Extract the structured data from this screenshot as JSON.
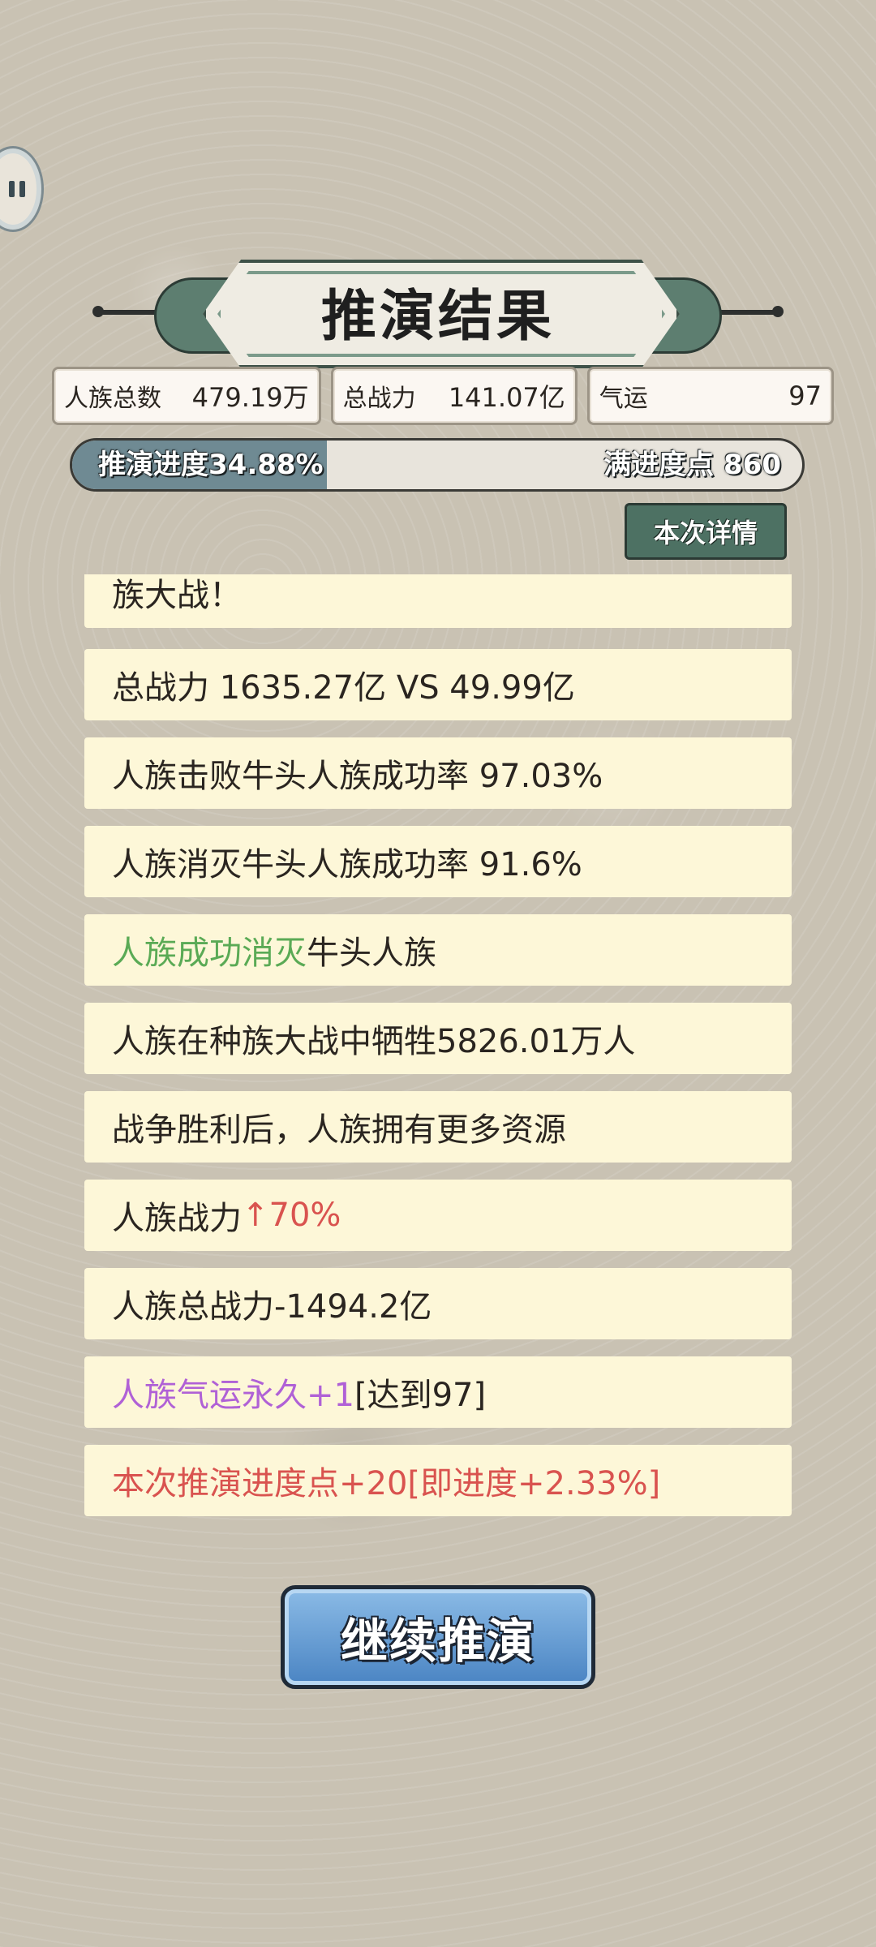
{
  "title": "推演结果",
  "stats": [
    {
      "label": "人族总数",
      "value": "479.19万"
    },
    {
      "label": "总战力",
      "value": "141.07亿"
    },
    {
      "label": "气运",
      "value": "97"
    }
  ],
  "progress": {
    "label": "推演进度34.88%",
    "percent": 34.88,
    "right_label": "满进度点 860"
  },
  "details_button": "本次详情",
  "log": [
    {
      "parts": [
        {
          "text": "族大战！",
          "color": "default"
        }
      ]
    },
    {
      "parts": [
        {
          "text": "总战力 1635.27亿 VS 49.99亿",
          "color": "default"
        }
      ]
    },
    {
      "parts": [
        {
          "text": "人族击败牛头人族成功率 97.03%",
          "color": "default"
        }
      ]
    },
    {
      "parts": [
        {
          "text": "人族消灭牛头人族成功率 91.6%",
          "color": "default"
        }
      ]
    },
    {
      "parts": [
        {
          "text": "人族成功消灭",
          "color": "green"
        },
        {
          "text": "牛头人族",
          "color": "default"
        }
      ]
    },
    {
      "parts": [
        {
          "text": "人族在种族大战中牺牲5826.01万人",
          "color": "default"
        }
      ]
    },
    {
      "parts": [
        {
          "text": "战争胜利后，人族拥有更多资源",
          "color": "default"
        }
      ]
    },
    {
      "parts": [
        {
          "text": "人族战力 ",
          "color": "default"
        },
        {
          "text": "↑70%",
          "color": "red"
        }
      ]
    },
    {
      "parts": [
        {
          "text": "人族总战力-1494.2亿",
          "color": "default"
        }
      ]
    },
    {
      "parts": [
        {
          "text": "人族气运永久+1",
          "color": "purple"
        },
        {
          "text": "[达到97]",
          "color": "default"
        }
      ]
    },
    {
      "parts": [
        {
          "text": "本次推演进度点+20[即进度+2.33%]",
          "color": "red"
        }
      ]
    }
  ],
  "continue_button": "继续推演",
  "colors": {
    "green": "#5aaa55",
    "red": "#d9534f",
    "purple": "#b061d6",
    "card_bg": "#fdf7d8"
  }
}
